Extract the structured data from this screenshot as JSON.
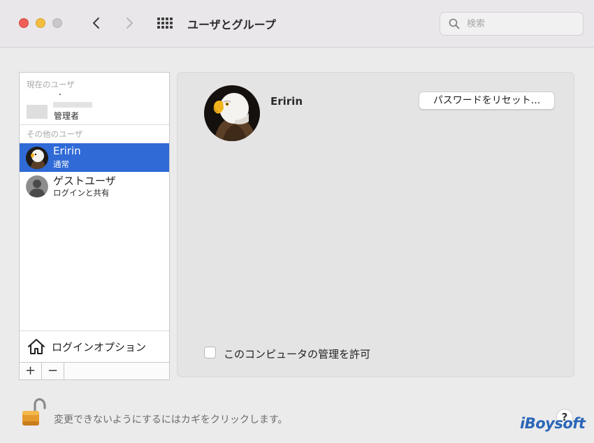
{
  "window": {
    "title": "ユーザとグループ",
    "search_placeholder": "検索"
  },
  "sidebar": {
    "current_section": "現在のユーザ",
    "current_user": {
      "role": "管理者"
    },
    "other_section": "その他のユーザ",
    "users": [
      {
        "name": "Eririn",
        "role": "通常",
        "selected": true,
        "avatar": "eagle-icon"
      },
      {
        "name": "ゲストユーザ",
        "role": "ログインと共有",
        "selected": false,
        "avatar": "guest-user-icon"
      }
    ],
    "login_options_label": "ログインオプション",
    "add_label": "+",
    "remove_label": "−"
  },
  "main": {
    "user_name": "Eririn",
    "reset_password_label": "パスワードをリセット...",
    "admin_checkbox_label": "このコンピュータの管理を許可",
    "admin_checked": false
  },
  "footer": {
    "lock_text": "変更できないようにするにはカギをクリックします。",
    "help_label": "?",
    "watermark": "iBoysoft"
  },
  "colors": {
    "selection": "#2f6ad6",
    "close": "#ed5f57",
    "minimize": "#f3bd3f",
    "watermark": "#2a66b8"
  }
}
